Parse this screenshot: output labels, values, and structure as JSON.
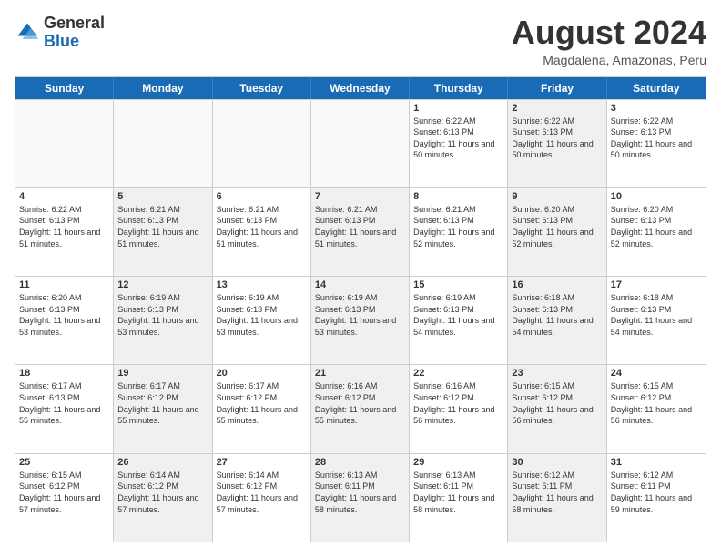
{
  "header": {
    "logo_general": "General",
    "logo_blue": "Blue",
    "month_year": "August 2024",
    "location": "Magdalena, Amazonas, Peru"
  },
  "days_of_week": [
    "Sunday",
    "Monday",
    "Tuesday",
    "Wednesday",
    "Thursday",
    "Friday",
    "Saturday"
  ],
  "weeks": [
    [
      {
        "day": "",
        "sunrise": "",
        "sunset": "",
        "daylight": "",
        "shaded": false,
        "empty": true
      },
      {
        "day": "",
        "sunrise": "",
        "sunset": "",
        "daylight": "",
        "shaded": false,
        "empty": true
      },
      {
        "day": "",
        "sunrise": "",
        "sunset": "",
        "daylight": "",
        "shaded": false,
        "empty": true
      },
      {
        "day": "",
        "sunrise": "",
        "sunset": "",
        "daylight": "",
        "shaded": false,
        "empty": true
      },
      {
        "day": "1",
        "sunrise": "Sunrise: 6:22 AM",
        "sunset": "Sunset: 6:13 PM",
        "daylight": "Daylight: 11 hours and 50 minutes.",
        "shaded": false,
        "empty": false
      },
      {
        "day": "2",
        "sunrise": "Sunrise: 6:22 AM",
        "sunset": "Sunset: 6:13 PM",
        "daylight": "Daylight: 11 hours and 50 minutes.",
        "shaded": true,
        "empty": false
      },
      {
        "day": "3",
        "sunrise": "Sunrise: 6:22 AM",
        "sunset": "Sunset: 6:13 PM",
        "daylight": "Daylight: 11 hours and 50 minutes.",
        "shaded": false,
        "empty": false
      }
    ],
    [
      {
        "day": "4",
        "sunrise": "Sunrise: 6:22 AM",
        "sunset": "Sunset: 6:13 PM",
        "daylight": "Daylight: 11 hours and 51 minutes.",
        "shaded": false,
        "empty": false
      },
      {
        "day": "5",
        "sunrise": "Sunrise: 6:21 AM",
        "sunset": "Sunset: 6:13 PM",
        "daylight": "Daylight: 11 hours and 51 minutes.",
        "shaded": true,
        "empty": false
      },
      {
        "day": "6",
        "sunrise": "Sunrise: 6:21 AM",
        "sunset": "Sunset: 6:13 PM",
        "daylight": "Daylight: 11 hours and 51 minutes.",
        "shaded": false,
        "empty": false
      },
      {
        "day": "7",
        "sunrise": "Sunrise: 6:21 AM",
        "sunset": "Sunset: 6:13 PM",
        "daylight": "Daylight: 11 hours and 51 minutes.",
        "shaded": true,
        "empty": false
      },
      {
        "day": "8",
        "sunrise": "Sunrise: 6:21 AM",
        "sunset": "Sunset: 6:13 PM",
        "daylight": "Daylight: 11 hours and 52 minutes.",
        "shaded": false,
        "empty": false
      },
      {
        "day": "9",
        "sunrise": "Sunrise: 6:20 AM",
        "sunset": "Sunset: 6:13 PM",
        "daylight": "Daylight: 11 hours and 52 minutes.",
        "shaded": true,
        "empty": false
      },
      {
        "day": "10",
        "sunrise": "Sunrise: 6:20 AM",
        "sunset": "Sunset: 6:13 PM",
        "daylight": "Daylight: 11 hours and 52 minutes.",
        "shaded": false,
        "empty": false
      }
    ],
    [
      {
        "day": "11",
        "sunrise": "Sunrise: 6:20 AM",
        "sunset": "Sunset: 6:13 PM",
        "daylight": "Daylight: 11 hours and 53 minutes.",
        "shaded": false,
        "empty": false
      },
      {
        "day": "12",
        "sunrise": "Sunrise: 6:19 AM",
        "sunset": "Sunset: 6:13 PM",
        "daylight": "Daylight: 11 hours and 53 minutes.",
        "shaded": true,
        "empty": false
      },
      {
        "day": "13",
        "sunrise": "Sunrise: 6:19 AM",
        "sunset": "Sunset: 6:13 PM",
        "daylight": "Daylight: 11 hours and 53 minutes.",
        "shaded": false,
        "empty": false
      },
      {
        "day": "14",
        "sunrise": "Sunrise: 6:19 AM",
        "sunset": "Sunset: 6:13 PM",
        "daylight": "Daylight: 11 hours and 53 minutes.",
        "shaded": true,
        "empty": false
      },
      {
        "day": "15",
        "sunrise": "Sunrise: 6:19 AM",
        "sunset": "Sunset: 6:13 PM",
        "daylight": "Daylight: 11 hours and 54 minutes.",
        "shaded": false,
        "empty": false
      },
      {
        "day": "16",
        "sunrise": "Sunrise: 6:18 AM",
        "sunset": "Sunset: 6:13 PM",
        "daylight": "Daylight: 11 hours and 54 minutes.",
        "shaded": true,
        "empty": false
      },
      {
        "day": "17",
        "sunrise": "Sunrise: 6:18 AM",
        "sunset": "Sunset: 6:13 PM",
        "daylight": "Daylight: 11 hours and 54 minutes.",
        "shaded": false,
        "empty": false
      }
    ],
    [
      {
        "day": "18",
        "sunrise": "Sunrise: 6:17 AM",
        "sunset": "Sunset: 6:13 PM",
        "daylight": "Daylight: 11 hours and 55 minutes.",
        "shaded": false,
        "empty": false
      },
      {
        "day": "19",
        "sunrise": "Sunrise: 6:17 AM",
        "sunset": "Sunset: 6:12 PM",
        "daylight": "Daylight: 11 hours and 55 minutes.",
        "shaded": true,
        "empty": false
      },
      {
        "day": "20",
        "sunrise": "Sunrise: 6:17 AM",
        "sunset": "Sunset: 6:12 PM",
        "daylight": "Daylight: 11 hours and 55 minutes.",
        "shaded": false,
        "empty": false
      },
      {
        "day": "21",
        "sunrise": "Sunrise: 6:16 AM",
        "sunset": "Sunset: 6:12 PM",
        "daylight": "Daylight: 11 hours and 55 minutes.",
        "shaded": true,
        "empty": false
      },
      {
        "day": "22",
        "sunrise": "Sunrise: 6:16 AM",
        "sunset": "Sunset: 6:12 PM",
        "daylight": "Daylight: 11 hours and 56 minutes.",
        "shaded": false,
        "empty": false
      },
      {
        "day": "23",
        "sunrise": "Sunrise: 6:15 AM",
        "sunset": "Sunset: 6:12 PM",
        "daylight": "Daylight: 11 hours and 56 minutes.",
        "shaded": true,
        "empty": false
      },
      {
        "day": "24",
        "sunrise": "Sunrise: 6:15 AM",
        "sunset": "Sunset: 6:12 PM",
        "daylight": "Daylight: 11 hours and 56 minutes.",
        "shaded": false,
        "empty": false
      }
    ],
    [
      {
        "day": "25",
        "sunrise": "Sunrise: 6:15 AM",
        "sunset": "Sunset: 6:12 PM",
        "daylight": "Daylight: 11 hours and 57 minutes.",
        "shaded": false,
        "empty": false
      },
      {
        "day": "26",
        "sunrise": "Sunrise: 6:14 AM",
        "sunset": "Sunset: 6:12 PM",
        "daylight": "Daylight: 11 hours and 57 minutes.",
        "shaded": true,
        "empty": false
      },
      {
        "day": "27",
        "sunrise": "Sunrise: 6:14 AM",
        "sunset": "Sunset: 6:12 PM",
        "daylight": "Daylight: 11 hours and 57 minutes.",
        "shaded": false,
        "empty": false
      },
      {
        "day": "28",
        "sunrise": "Sunrise: 6:13 AM",
        "sunset": "Sunset: 6:11 PM",
        "daylight": "Daylight: 11 hours and 58 minutes.",
        "shaded": true,
        "empty": false
      },
      {
        "day": "29",
        "sunrise": "Sunrise: 6:13 AM",
        "sunset": "Sunset: 6:11 PM",
        "daylight": "Daylight: 11 hours and 58 minutes.",
        "shaded": false,
        "empty": false
      },
      {
        "day": "30",
        "sunrise": "Sunrise: 6:12 AM",
        "sunset": "Sunset: 6:11 PM",
        "daylight": "Daylight: 11 hours and 58 minutes.",
        "shaded": true,
        "empty": false
      },
      {
        "day": "31",
        "sunrise": "Sunrise: 6:12 AM",
        "sunset": "Sunset: 6:11 PM",
        "daylight": "Daylight: 11 hours and 59 minutes.",
        "shaded": false,
        "empty": false
      }
    ]
  ]
}
